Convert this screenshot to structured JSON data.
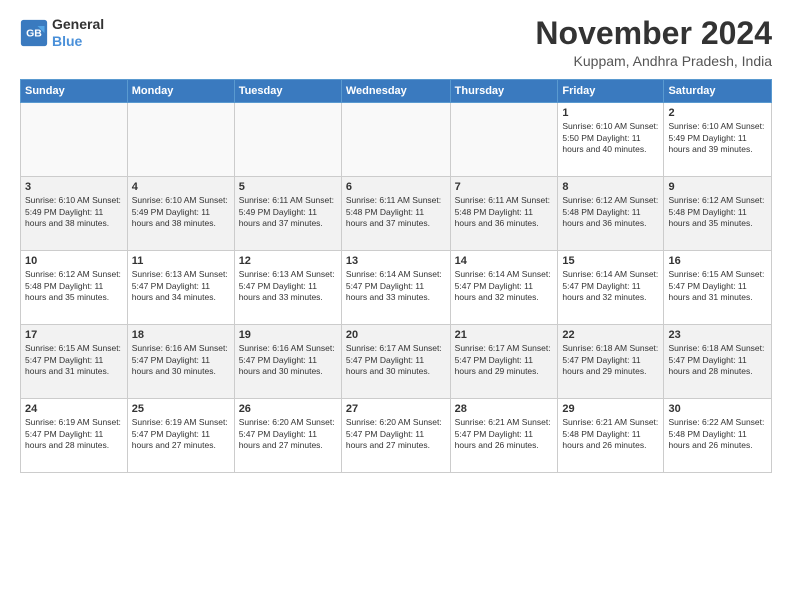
{
  "logo": {
    "line1": "General",
    "line2": "Blue"
  },
  "title": "November 2024",
  "subtitle": "Kuppam, Andhra Pradesh, India",
  "headers": [
    "Sunday",
    "Monday",
    "Tuesday",
    "Wednesday",
    "Thursday",
    "Friday",
    "Saturday"
  ],
  "weeks": [
    [
      {
        "day": "",
        "info": ""
      },
      {
        "day": "",
        "info": ""
      },
      {
        "day": "",
        "info": ""
      },
      {
        "day": "",
        "info": ""
      },
      {
        "day": "",
        "info": ""
      },
      {
        "day": "1",
        "info": "Sunrise: 6:10 AM\nSunset: 5:50 PM\nDaylight: 11 hours and 40 minutes."
      },
      {
        "day": "2",
        "info": "Sunrise: 6:10 AM\nSunset: 5:49 PM\nDaylight: 11 hours and 39 minutes."
      }
    ],
    [
      {
        "day": "3",
        "info": "Sunrise: 6:10 AM\nSunset: 5:49 PM\nDaylight: 11 hours and 38 minutes."
      },
      {
        "day": "4",
        "info": "Sunrise: 6:10 AM\nSunset: 5:49 PM\nDaylight: 11 hours and 38 minutes."
      },
      {
        "day": "5",
        "info": "Sunrise: 6:11 AM\nSunset: 5:49 PM\nDaylight: 11 hours and 37 minutes."
      },
      {
        "day": "6",
        "info": "Sunrise: 6:11 AM\nSunset: 5:48 PM\nDaylight: 11 hours and 37 minutes."
      },
      {
        "day": "7",
        "info": "Sunrise: 6:11 AM\nSunset: 5:48 PM\nDaylight: 11 hours and 36 minutes."
      },
      {
        "day": "8",
        "info": "Sunrise: 6:12 AM\nSunset: 5:48 PM\nDaylight: 11 hours and 36 minutes."
      },
      {
        "day": "9",
        "info": "Sunrise: 6:12 AM\nSunset: 5:48 PM\nDaylight: 11 hours and 35 minutes."
      }
    ],
    [
      {
        "day": "10",
        "info": "Sunrise: 6:12 AM\nSunset: 5:48 PM\nDaylight: 11 hours and 35 minutes."
      },
      {
        "day": "11",
        "info": "Sunrise: 6:13 AM\nSunset: 5:47 PM\nDaylight: 11 hours and 34 minutes."
      },
      {
        "day": "12",
        "info": "Sunrise: 6:13 AM\nSunset: 5:47 PM\nDaylight: 11 hours and 33 minutes."
      },
      {
        "day": "13",
        "info": "Sunrise: 6:14 AM\nSunset: 5:47 PM\nDaylight: 11 hours and 33 minutes."
      },
      {
        "day": "14",
        "info": "Sunrise: 6:14 AM\nSunset: 5:47 PM\nDaylight: 11 hours and 32 minutes."
      },
      {
        "day": "15",
        "info": "Sunrise: 6:14 AM\nSunset: 5:47 PM\nDaylight: 11 hours and 32 minutes."
      },
      {
        "day": "16",
        "info": "Sunrise: 6:15 AM\nSunset: 5:47 PM\nDaylight: 11 hours and 31 minutes."
      }
    ],
    [
      {
        "day": "17",
        "info": "Sunrise: 6:15 AM\nSunset: 5:47 PM\nDaylight: 11 hours and 31 minutes."
      },
      {
        "day": "18",
        "info": "Sunrise: 6:16 AM\nSunset: 5:47 PM\nDaylight: 11 hours and 30 minutes."
      },
      {
        "day": "19",
        "info": "Sunrise: 6:16 AM\nSunset: 5:47 PM\nDaylight: 11 hours and 30 minutes."
      },
      {
        "day": "20",
        "info": "Sunrise: 6:17 AM\nSunset: 5:47 PM\nDaylight: 11 hours and 30 minutes."
      },
      {
        "day": "21",
        "info": "Sunrise: 6:17 AM\nSunset: 5:47 PM\nDaylight: 11 hours and 29 minutes."
      },
      {
        "day": "22",
        "info": "Sunrise: 6:18 AM\nSunset: 5:47 PM\nDaylight: 11 hours and 29 minutes."
      },
      {
        "day": "23",
        "info": "Sunrise: 6:18 AM\nSunset: 5:47 PM\nDaylight: 11 hours and 28 minutes."
      }
    ],
    [
      {
        "day": "24",
        "info": "Sunrise: 6:19 AM\nSunset: 5:47 PM\nDaylight: 11 hours and 28 minutes."
      },
      {
        "day": "25",
        "info": "Sunrise: 6:19 AM\nSunset: 5:47 PM\nDaylight: 11 hours and 27 minutes."
      },
      {
        "day": "26",
        "info": "Sunrise: 6:20 AM\nSunset: 5:47 PM\nDaylight: 11 hours and 27 minutes."
      },
      {
        "day": "27",
        "info": "Sunrise: 6:20 AM\nSunset: 5:47 PM\nDaylight: 11 hours and 27 minutes."
      },
      {
        "day": "28",
        "info": "Sunrise: 6:21 AM\nSunset: 5:47 PM\nDaylight: 11 hours and 26 minutes."
      },
      {
        "day": "29",
        "info": "Sunrise: 6:21 AM\nSunset: 5:48 PM\nDaylight: 11 hours and 26 minutes."
      },
      {
        "day": "30",
        "info": "Sunrise: 6:22 AM\nSunset: 5:48 PM\nDaylight: 11 hours and 26 minutes."
      }
    ]
  ]
}
